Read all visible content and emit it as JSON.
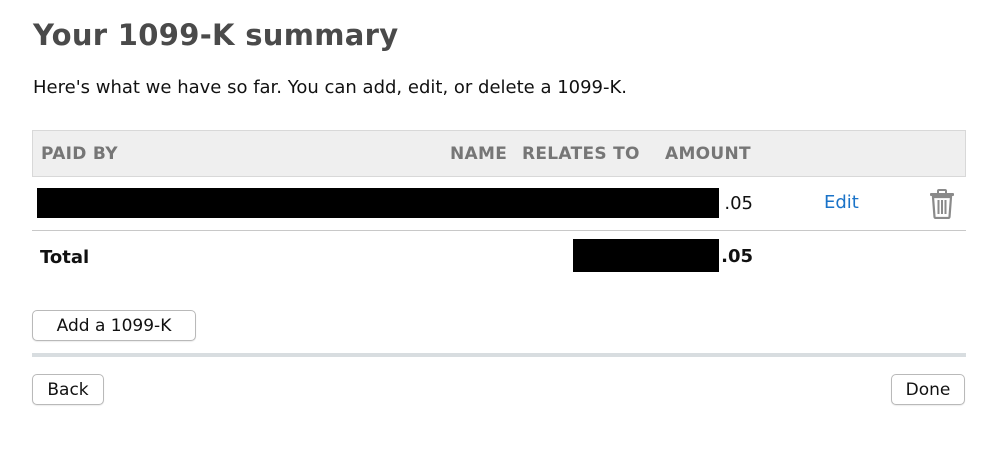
{
  "page": {
    "title": "Your 1099-K summary",
    "subtitle": "Here's what we have so far. You can add, edit, or delete a 1099-K."
  },
  "table": {
    "headers": {
      "paid_by": "PAID BY",
      "name": "NAME",
      "relates_to": "RELATES TO",
      "amount": "AMOUNT"
    },
    "rows": [
      {
        "amount": ".05",
        "edit_label": "Edit",
        "delete_icon": "trash-icon"
      }
    ],
    "total": {
      "label": "Total",
      "amount": ".05"
    }
  },
  "buttons": {
    "add": "Add a 1099-K",
    "back": "Back",
    "done": "Done"
  },
  "colors": {
    "link": "#1a73c8",
    "header_bg": "#efefef",
    "title": "#4a4a4a"
  }
}
